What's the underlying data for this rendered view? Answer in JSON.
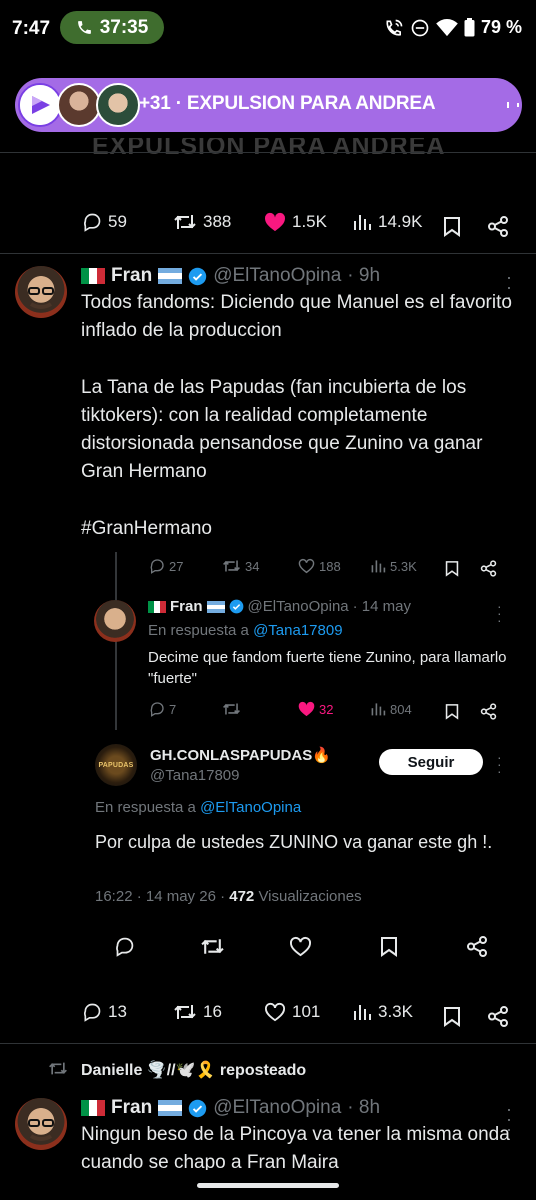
{
  "status_bar": {
    "time": "7:47",
    "call_timer": "37:35",
    "battery": "79 %"
  },
  "live_banner": {
    "text": "+31 · EXPULSION PARA ANDREA",
    "ghost_text": "EXPULSION PARA ANDREA",
    "accent": "#a46be6"
  },
  "top_actions": {
    "replies": "59",
    "reposts": "388",
    "likes": "1.5K",
    "views": "14.9K"
  },
  "tweet1": {
    "display_name": "Fran",
    "handle": "@ElTanoOpina",
    "time": "· 9h",
    "text_p1": "Todos fandoms: Diciendo que Manuel es el favorito inflado de la produccion",
    "text_p2": "La Tana de las Papudas (fan incubierta de los tiktokers): con la realidad completamente distorsionada pensandose que Zunino va ganar Gran Hermano",
    "hashtag": "#GranHermano",
    "actions": {
      "replies": "27",
      "reposts": "34",
      "likes": "188",
      "views": "5.3K"
    }
  },
  "reply1": {
    "display_name": "Fran",
    "handle": "@ElTanoOpina",
    "time": "· 14 may",
    "in_reply_prefix": "En respuesta a ",
    "in_reply_handle": "@Tana17809",
    "text": "Decime que fandom fuerte tiene Zunino, para llamarlo \"fuerte\"",
    "actions": {
      "replies": "7",
      "likes": "32",
      "views": "804"
    }
  },
  "quoted": {
    "display_name": "GH.CONLASPAPUDAS🔥",
    "handle": "@Tana17809",
    "follow_label": "Seguir",
    "avatar_text": "PAPUDAS",
    "in_reply_prefix": "En respuesta a ",
    "in_reply_handle": "@ElTanoOpina",
    "text": "Por culpa de ustedes ZUNINO va ganar este gh !.",
    "meta_time": "16:22 · 14 may 26 · ",
    "meta_views": "472",
    "meta_views_label": " Visualizaciones"
  },
  "tweet1_bottom_actions": {
    "replies": "13",
    "reposts": "16",
    "likes": "101",
    "views": "3.3K"
  },
  "repost_line": {
    "name": "Danielle",
    "emojis": "🌪️//🕊️🎗️",
    "label": "reposteado"
  },
  "tweet2": {
    "display_name": "Fran",
    "handle": "@ElTanoOpina",
    "time": "· 8h",
    "text": "Ningun beso de la Pincoya va tener la misma onda cuando se chapo a Fran Maira"
  },
  "colors": {
    "like_pink": "#f91880",
    "link_blue": "#1d9bf0",
    "muted_gray": "#71767b",
    "divider": "#2f3336",
    "call_green": "#3f6d2e"
  }
}
